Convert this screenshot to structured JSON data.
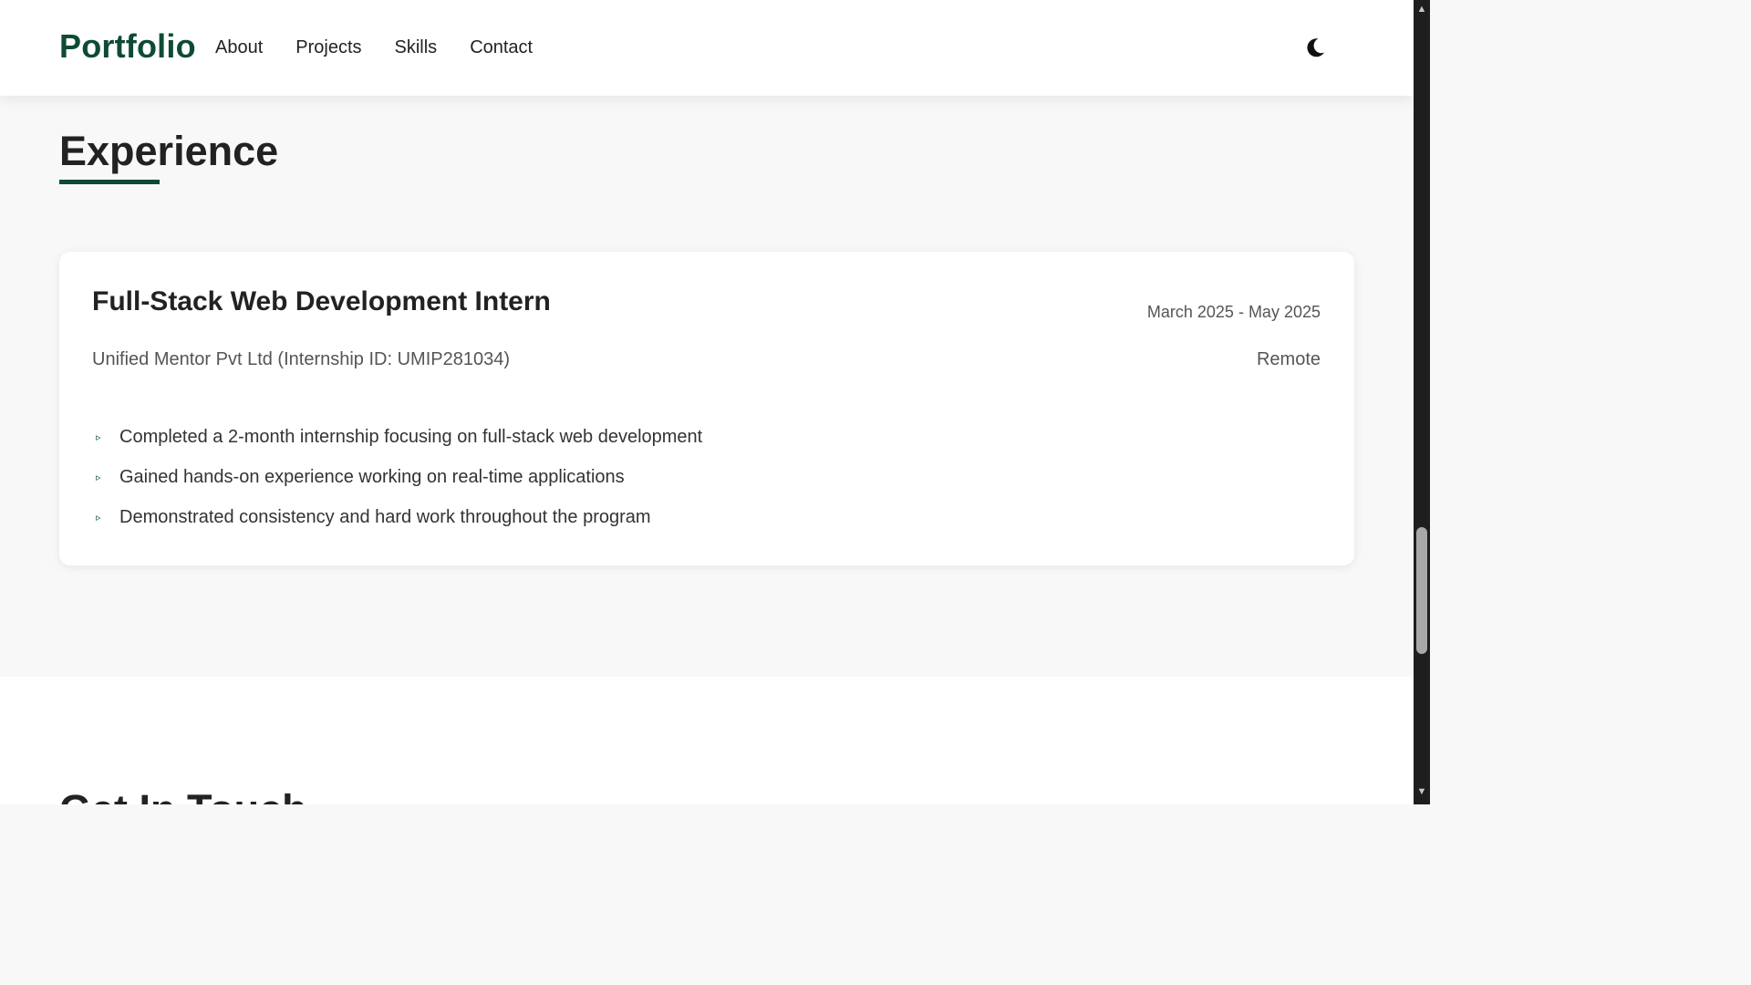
{
  "navbar": {
    "brand": "Portfolio",
    "links": [
      "About",
      "Projects",
      "Skills",
      "Contact"
    ],
    "theme_toggle_icon": "moon-icon"
  },
  "experience": {
    "title": "Experience",
    "accent_color": "#0f4b34",
    "entries": [
      {
        "role": "Full-Stack Web Development Intern",
        "dates": "March 2025 - May 2025",
        "company": "Unified Mentor Pvt Ltd (Internship ID: UMIP281034)",
        "location": "Remote",
        "bullets": [
          "Completed a 2-month internship focusing on full-stack web development",
          "Gained hands-on experience working on real-time applications",
          "Demonstrated consistency and hard work throughout the program"
        ]
      }
    ]
  },
  "next_section": {
    "title": "Get In Touch"
  },
  "scrollbar": {
    "up_icon": "scroll-up-arrow-icon",
    "down_icon": "scroll-down-arrow-icon"
  }
}
